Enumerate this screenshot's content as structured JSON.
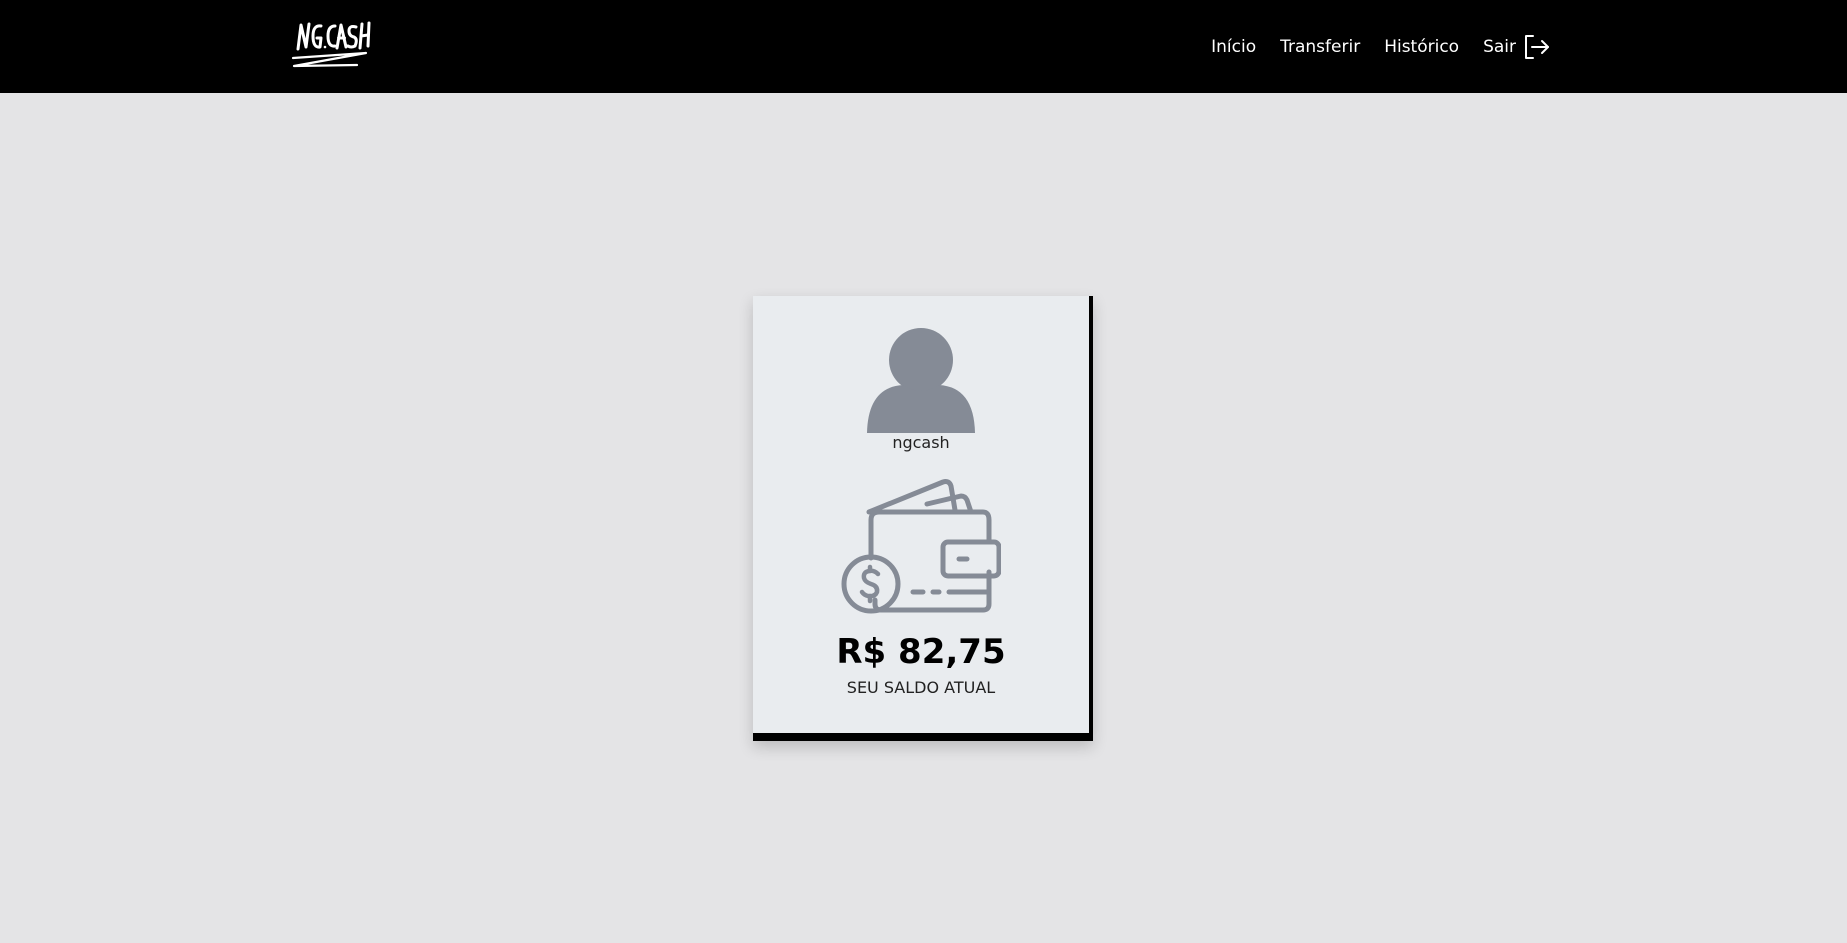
{
  "brand": {
    "name": "NG.CASH"
  },
  "nav": {
    "items": [
      {
        "label": "Início"
      },
      {
        "label": "Transferir"
      },
      {
        "label": "Histórico"
      }
    ],
    "logout": {
      "label": "Sair",
      "icon": "logout-icon"
    }
  },
  "account": {
    "avatar_icon": "user-avatar-icon",
    "username": "ngcash",
    "wallet_icon": "wallet-icon",
    "balance": "R$ 82,75",
    "balance_label": "SEU SALDO ATUAL"
  },
  "colors": {
    "topbar": "#000000",
    "background": "#e4e4e6",
    "card": "#e9ecef",
    "icon_gray": "#858b96"
  }
}
